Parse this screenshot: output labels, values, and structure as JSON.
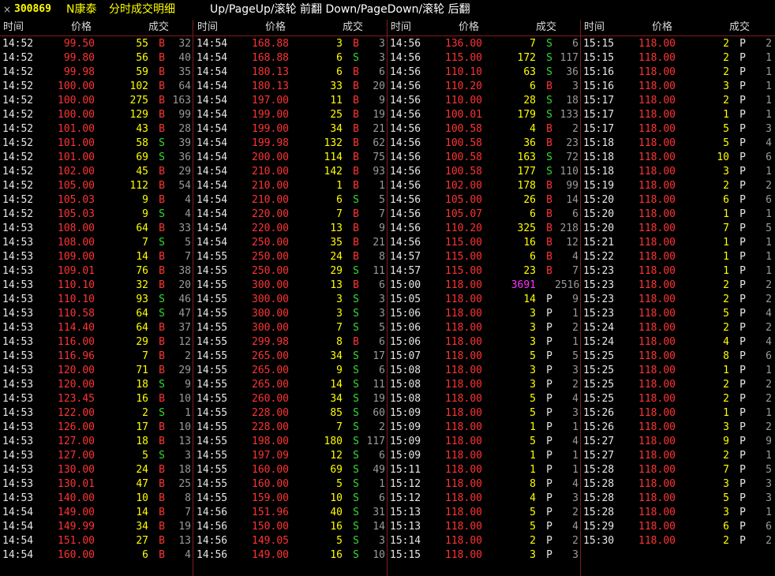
{
  "topbar": {
    "close_glyph": "×",
    "code": "300869",
    "name": "N康泰",
    "title": "分时成交明细",
    "hint": "Up/PageUp/滚轮 前翻 Down/PageDown/滚轮 后翻"
  },
  "columns": {
    "time": "时间",
    "price": "价格",
    "vol": "成交"
  },
  "colors": {
    "background": "#000000",
    "price": "#ff3333",
    "volume": "#ffff00",
    "buy": "#ff3333",
    "sell": "#33dd33",
    "special_volume": "#ff33ff",
    "separator": "#7f1d1d"
  },
  "panels": [
    {
      "rows": [
        [
          "14:52",
          "99.50",
          "55",
          "B",
          "32"
        ],
        [
          "14:52",
          "99.80",
          "56",
          "B",
          "40"
        ],
        [
          "14:52",
          "99.98",
          "59",
          "B",
          "35"
        ],
        [
          "14:52",
          "100.00",
          "102",
          "B",
          "64"
        ],
        [
          "14:52",
          "100.00",
          "275",
          "B",
          "163"
        ],
        [
          "14:52",
          "100.00",
          "129",
          "B",
          "99"
        ],
        [
          "14:52",
          "101.00",
          "43",
          "B",
          "28"
        ],
        [
          "14:52",
          "101.00",
          "58",
          "S",
          "39"
        ],
        [
          "14:52",
          "101.00",
          "69",
          "S",
          "36"
        ],
        [
          "14:52",
          "102.00",
          "45",
          "B",
          "29"
        ],
        [
          "14:52",
          "105.00",
          "112",
          "B",
          "54"
        ],
        [
          "14:52",
          "105.03",
          "9",
          "B",
          "4"
        ],
        [
          "14:52",
          "105.03",
          "9",
          "S",
          "4"
        ],
        [
          "14:53",
          "108.00",
          "64",
          "B",
          "33"
        ],
        [
          "14:53",
          "108.00",
          "7",
          "S",
          "5"
        ],
        [
          "14:53",
          "109.00",
          "14",
          "B",
          "7"
        ],
        [
          "14:53",
          "109.01",
          "76",
          "B",
          "38"
        ],
        [
          "14:53",
          "110.10",
          "32",
          "B",
          "20"
        ],
        [
          "14:53",
          "110.10",
          "93",
          "S",
          "46"
        ],
        [
          "14:53",
          "110.58",
          "64",
          "S",
          "47"
        ],
        [
          "14:53",
          "114.40",
          "64",
          "B",
          "37"
        ],
        [
          "14:53",
          "116.00",
          "29",
          "B",
          "12"
        ],
        [
          "14:53",
          "116.96",
          "7",
          "B",
          "2"
        ],
        [
          "14:53",
          "120.00",
          "71",
          "B",
          "29"
        ],
        [
          "14:53",
          "120.00",
          "18",
          "S",
          "9"
        ],
        [
          "14:53",
          "123.45",
          "16",
          "B",
          "10"
        ],
        [
          "14:53",
          "122.00",
          "2",
          "S",
          "1"
        ],
        [
          "14:53",
          "126.00",
          "17",
          "B",
          "10"
        ],
        [
          "14:53",
          "127.00",
          "18",
          "B",
          "13"
        ],
        [
          "14:53",
          "127.00",
          "5",
          "S",
          "3"
        ],
        [
          "14:53",
          "130.00",
          "24",
          "B",
          "18"
        ],
        [
          "14:53",
          "130.01",
          "47",
          "B",
          "25"
        ],
        [
          "14:53",
          "140.00",
          "10",
          "B",
          "8"
        ],
        [
          "14:54",
          "149.00",
          "14",
          "B",
          "7"
        ],
        [
          "14:54",
          "149.99",
          "34",
          "B",
          "19"
        ],
        [
          "14:54",
          "151.00",
          "27",
          "B",
          "13"
        ],
        [
          "14:54",
          "160.00",
          "6",
          "B",
          "4"
        ]
      ]
    },
    {
      "rows": [
        [
          "14:54",
          "168.88",
          "3",
          "B",
          "3"
        ],
        [
          "14:54",
          "168.88",
          "6",
          "S",
          "3"
        ],
        [
          "14:54",
          "180.13",
          "6",
          "B",
          "6"
        ],
        [
          "14:54",
          "180.13",
          "33",
          "B",
          "20"
        ],
        [
          "14:54",
          "197.00",
          "11",
          "B",
          "9"
        ],
        [
          "14:54",
          "199.00",
          "25",
          "B",
          "19"
        ],
        [
          "14:54",
          "199.00",
          "34",
          "B",
          "21"
        ],
        [
          "14:54",
          "199.98",
          "132",
          "B",
          "62"
        ],
        [
          "14:54",
          "200.00",
          "114",
          "B",
          "75"
        ],
        [
          "14:54",
          "210.00",
          "142",
          "B",
          "93"
        ],
        [
          "14:54",
          "210.00",
          "1",
          "B",
          "1"
        ],
        [
          "14:54",
          "210.00",
          "6",
          "S",
          "5"
        ],
        [
          "14:54",
          "220.00",
          "7",
          "B",
          "7"
        ],
        [
          "14:54",
          "220.00",
          "13",
          "B",
          "9"
        ],
        [
          "14:54",
          "250.00",
          "35",
          "B",
          "21"
        ],
        [
          "14:55",
          "250.00",
          "24",
          "B",
          "8"
        ],
        [
          "14:55",
          "250.00",
          "29",
          "S",
          "11"
        ],
        [
          "14:55",
          "300.00",
          "13",
          "B",
          "6"
        ],
        [
          "14:55",
          "300.00",
          "3",
          "S",
          "3"
        ],
        [
          "14:55",
          "300.00",
          "3",
          "S",
          "3"
        ],
        [
          "14:55",
          "300.00",
          "7",
          "S",
          "5"
        ],
        [
          "14:55",
          "299.98",
          "8",
          "B",
          "6"
        ],
        [
          "14:55",
          "265.00",
          "34",
          "S",
          "17"
        ],
        [
          "14:55",
          "265.00",
          "9",
          "S",
          "6"
        ],
        [
          "14:55",
          "265.00",
          "14",
          "S",
          "11"
        ],
        [
          "14:55",
          "260.00",
          "34",
          "S",
          "19"
        ],
        [
          "14:55",
          "228.00",
          "85",
          "S",
          "60"
        ],
        [
          "14:55",
          "228.00",
          "7",
          "S",
          "2"
        ],
        [
          "14:55",
          "198.00",
          "180",
          "S",
          "117"
        ],
        [
          "14:55",
          "197.09",
          "12",
          "S",
          "6"
        ],
        [
          "14:55",
          "160.00",
          "69",
          "S",
          "49"
        ],
        [
          "14:55",
          "160.00",
          "5",
          "S",
          "1"
        ],
        [
          "14:55",
          "159.00",
          "10",
          "S",
          "6"
        ],
        [
          "14:56",
          "151.96",
          "40",
          "S",
          "31"
        ],
        [
          "14:56",
          "150.00",
          "16",
          "S",
          "14"
        ],
        [
          "14:56",
          "149.05",
          "5",
          "S",
          "3"
        ],
        [
          "14:56",
          "149.00",
          "16",
          "S",
          "10"
        ]
      ]
    },
    {
      "rows": [
        [
          "14:56",
          "136.00",
          "7",
          "S",
          "6"
        ],
        [
          "14:56",
          "115.00",
          "172",
          "S",
          "117"
        ],
        [
          "14:56",
          "110.10",
          "63",
          "S",
          "36"
        ],
        [
          "14:56",
          "110.20",
          "6",
          "B",
          "3"
        ],
        [
          "14:56",
          "110.00",
          "28",
          "S",
          "18"
        ],
        [
          "14:56",
          "100.01",
          "179",
          "S",
          "133"
        ],
        [
          "14:56",
          "100.58",
          "4",
          "B",
          "2"
        ],
        [
          "14:56",
          "100.58",
          "36",
          "B",
          "23"
        ],
        [
          "14:56",
          "100.58",
          "163",
          "S",
          "72"
        ],
        [
          "14:56",
          "100.58",
          "177",
          "S",
          "110"
        ],
        [
          "14:56",
          "102.00",
          "178",
          "B",
          "99"
        ],
        [
          "14:56",
          "105.00",
          "26",
          "B",
          "14"
        ],
        [
          "14:56",
          "105.07",
          "6",
          "B",
          "6"
        ],
        [
          "14:56",
          "110.20",
          "325",
          "B",
          "218"
        ],
        [
          "14:56",
          "115.00",
          "16",
          "B",
          "12"
        ],
        [
          "14:57",
          "115.00",
          "6",
          "B",
          "4"
        ],
        [
          "14:57",
          "115.00",
          "23",
          "B",
          "7"
        ],
        [
          "15:00",
          "118.00",
          "3691",
          "",
          "2516"
        ],
        [
          "15:05",
          "118.00",
          "14",
          "P",
          "9"
        ],
        [
          "15:06",
          "118.00",
          "3",
          "P",
          "1"
        ],
        [
          "15:06",
          "118.00",
          "3",
          "P",
          "2"
        ],
        [
          "15:06",
          "118.00",
          "3",
          "P",
          "1"
        ],
        [
          "15:07",
          "118.00",
          "5",
          "P",
          "5"
        ],
        [
          "15:08",
          "118.00",
          "3",
          "P",
          "3"
        ],
        [
          "15:08",
          "118.00",
          "3",
          "P",
          "2"
        ],
        [
          "15:08",
          "118.00",
          "5",
          "P",
          "4"
        ],
        [
          "15:09",
          "118.00",
          "5",
          "P",
          "3"
        ],
        [
          "15:09",
          "118.00",
          "1",
          "P",
          "1"
        ],
        [
          "15:09",
          "118.00",
          "5",
          "P",
          "4"
        ],
        [
          "15:09",
          "118.00",
          "1",
          "P",
          "1"
        ],
        [
          "15:11",
          "118.00",
          "1",
          "P",
          "1"
        ],
        [
          "15:12",
          "118.00",
          "8",
          "P",
          "4"
        ],
        [
          "15:12",
          "118.00",
          "4",
          "P",
          "3"
        ],
        [
          "15:13",
          "118.00",
          "5",
          "P",
          "2"
        ],
        [
          "15:13",
          "118.00",
          "5",
          "P",
          "4"
        ],
        [
          "15:14",
          "118.00",
          "2",
          "P",
          "2"
        ],
        [
          "15:15",
          "118.00",
          "3",
          "P",
          "3"
        ]
      ]
    },
    {
      "rows": [
        [
          "15:15",
          "118.00",
          "2",
          "P",
          "2"
        ],
        [
          "15:15",
          "118.00",
          "2",
          "P",
          "1"
        ],
        [
          "15:16",
          "118.00",
          "2",
          "P",
          "1"
        ],
        [
          "15:16",
          "118.00",
          "3",
          "P",
          "1"
        ],
        [
          "15:17",
          "118.00",
          "2",
          "P",
          "1"
        ],
        [
          "15:17",
          "118.00",
          "1",
          "P",
          "1"
        ],
        [
          "15:17",
          "118.00",
          "5",
          "P",
          "3"
        ],
        [
          "15:18",
          "118.00",
          "5",
          "P",
          "4"
        ],
        [
          "15:18",
          "118.00",
          "10",
          "P",
          "6"
        ],
        [
          "15:18",
          "118.00",
          "3",
          "P",
          "1"
        ],
        [
          "15:19",
          "118.00",
          "2",
          "P",
          "2"
        ],
        [
          "15:20",
          "118.00",
          "6",
          "P",
          "6"
        ],
        [
          "15:20",
          "118.00",
          "1",
          "P",
          "1"
        ],
        [
          "15:20",
          "118.00",
          "7",
          "P",
          "5"
        ],
        [
          "15:21",
          "118.00",
          "1",
          "P",
          "1"
        ],
        [
          "15:22",
          "118.00",
          "1",
          "P",
          "1"
        ],
        [
          "15:23",
          "118.00",
          "1",
          "P",
          "1"
        ],
        [
          "15:23",
          "118.00",
          "2",
          "P",
          "2"
        ],
        [
          "15:23",
          "118.00",
          "2",
          "P",
          "2"
        ],
        [
          "15:23",
          "118.00",
          "5",
          "P",
          "4"
        ],
        [
          "15:24",
          "118.00",
          "2",
          "P",
          "2"
        ],
        [
          "15:24",
          "118.00",
          "4",
          "P",
          "4"
        ],
        [
          "15:25",
          "118.00",
          "8",
          "P",
          "6"
        ],
        [
          "15:25",
          "118.00",
          "1",
          "P",
          "1"
        ],
        [
          "15:25",
          "118.00",
          "2",
          "P",
          "2"
        ],
        [
          "15:25",
          "118.00",
          "2",
          "P",
          "2"
        ],
        [
          "15:26",
          "118.00",
          "1",
          "P",
          "1"
        ],
        [
          "15:26",
          "118.00",
          "3",
          "P",
          "2"
        ],
        [
          "15:27",
          "118.00",
          "9",
          "P",
          "9"
        ],
        [
          "15:27",
          "118.00",
          "2",
          "P",
          "1"
        ],
        [
          "15:28",
          "118.00",
          "7",
          "P",
          "5"
        ],
        [
          "15:28",
          "118.00",
          "3",
          "P",
          "3"
        ],
        [
          "15:28",
          "118.00",
          "5",
          "P",
          "3"
        ],
        [
          "15:28",
          "118.00",
          "3",
          "P",
          "1"
        ],
        [
          "15:29",
          "118.00",
          "6",
          "P",
          "6"
        ],
        [
          "15:30",
          "118.00",
          "2",
          "P",
          "2"
        ]
      ]
    }
  ]
}
